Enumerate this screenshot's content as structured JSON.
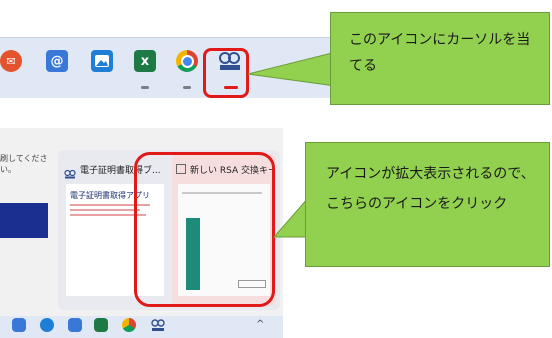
{
  "top_shot": {
    "taskbar_icons": [
      {
        "name": "outlook-icon",
        "glyph": "✉",
        "color": "#e2532e"
      },
      {
        "name": "mail-at-icon",
        "glyph": "@",
        "color": "#3a78d8"
      },
      {
        "name": "photos-icon",
        "glyph": "▲",
        "color": "#1f7fd6"
      },
      {
        "name": "excel-icon",
        "glyph": "x",
        "color": "#1d7a44"
      },
      {
        "name": "chrome-icon",
        "glyph": "",
        "color": "#f2b600"
      },
      {
        "name": "certificate-app-icon",
        "glyph": "",
        "color": "#2f4f8f"
      }
    ],
    "callout_text": "このアイコンにカーソルを当てる"
  },
  "bottom_shot": {
    "page_text": "刷してください。",
    "thumb_left_title": "電子証明書取得ブ...",
    "thumb_left_heading": "電子証明書取得アプリ",
    "thumb_right_title": "新しい RSA 交換キーを作..."
  },
  "bottom_callout_text": "アイコンが拡大表示されるので、こちらのアイコンをクリック",
  "colors": {
    "highlight": "#e01919",
    "callout": "#92d050",
    "taskbar": "#dfe8f4"
  }
}
